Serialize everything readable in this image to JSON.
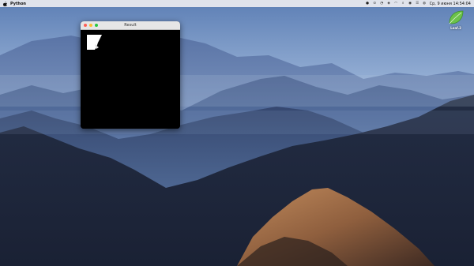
{
  "menubar": {
    "app_name": "Python",
    "status_icons": [
      "stop-icon",
      "alarm-icon",
      "notification-icon",
      "shield-icon",
      "wifi-icon",
      "search-icon",
      "user-icon",
      "control-center-icon",
      "siri-icon"
    ],
    "clock": "Cp, 9 июня   14:54:04"
  },
  "window": {
    "title": "Result"
  },
  "desktop_icon": {
    "label": "Leaf.2"
  },
  "colors": {
    "menubar_bg": "#ebebf0",
    "window_bg": "#000000",
    "leaf_green": "#6cc24a"
  }
}
